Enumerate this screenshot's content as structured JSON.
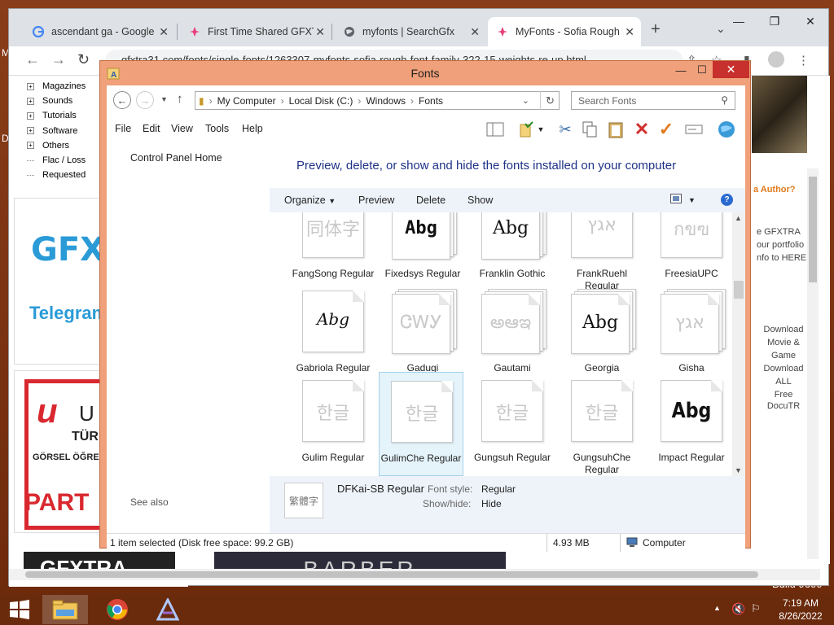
{
  "desktop": {
    "build_fragment": "Build 9600",
    "left_fragment_1": "M",
    "left_fragment_2": "D"
  },
  "browser": {
    "tabs": [
      {
        "title": "ascendant ga - Google",
        "icon": "google-icon"
      },
      {
        "title": "First Time Shared GFXT",
        "icon": "gfxtra-icon"
      },
      {
        "title": "myfonts | SearchGfx",
        "icon": "globe-icon"
      },
      {
        "title": "MyFonts - Sofia Rough",
        "icon": "gfxtra-icon"
      }
    ],
    "url": "gfxtra31.com/fonts/single-fonts/1263307-myfonts-sofia-rough-font-family-322-15-weights-re-up.html",
    "tree_items": [
      "Magazines",
      "Sounds",
      "Tutorials",
      "Software",
      "Others",
      "Flac / Loss",
      "Requested"
    ],
    "left_banner_1": "GFX",
    "left_banner_2": "Telegram",
    "ad_tur": "TÜR",
    "ad_gorsel": "GÖRSEL ÖĞRE",
    "ad_part": "PART",
    "ad_u": "u",
    "ad_u2": "U",
    "bottom_banner_1": "GFXTRA",
    "bottom_banner_2": "BARBER",
    "right_col": {
      "author_q": "a Author?",
      "gfxtra_text": "e GFXTRA\nour portfolio\nnfo to HERE",
      "download_movie": "Download\nMovie & Game",
      "download_all": "Download ALL\nFree",
      "docutr": "DocuTR"
    }
  },
  "explorer": {
    "title": "Fonts",
    "breadcrumb": [
      "My Computer",
      "Local Disk (C:)",
      "Windows",
      "Fonts"
    ],
    "search_placeholder": "Search Fonts",
    "menu": [
      "File",
      "Edit",
      "View",
      "Tools",
      "Help"
    ],
    "left": {
      "control_panel_home": "Control Panel Home",
      "see_also": "See also"
    },
    "heading": "Preview, delete, or show and hide the fonts installed on your computer",
    "commands": [
      "Organize",
      "Preview",
      "Delete",
      "Show"
    ],
    "fonts": [
      {
        "name": "FangSong Regular",
        "sample": "同体字",
        "style": "faded"
      },
      {
        "name": "Fixedsys Regular",
        "sample": "Abg",
        "style": "bold-stack"
      },
      {
        "name": "Franklin Gothic",
        "sample": "Abg",
        "style": "stack"
      },
      {
        "name": "FrankRuehl Regular",
        "sample": "אגץ",
        "style": "faded"
      },
      {
        "name": "FreesiaUPC",
        "sample": "กขฃ",
        "style": "faded"
      },
      {
        "name": "Gabriola Regular",
        "sample": "Abg",
        "style": "single"
      },
      {
        "name": "Gadugi",
        "sample": "ᏣᎳᎩ",
        "style": "faded-stack"
      },
      {
        "name": "Gautami",
        "sample": "అఆఇ",
        "style": "faded-stack"
      },
      {
        "name": "Georgia",
        "sample": "Abg",
        "style": "stack"
      },
      {
        "name": "Gisha",
        "sample": "אגץ",
        "style": "faded-stack"
      },
      {
        "name": "Gulim Regular",
        "sample": "한글",
        "style": "faded"
      },
      {
        "name": "GulimChe Regular",
        "sample": "한글",
        "style": "faded-selected"
      },
      {
        "name": "Gungsuh Regular",
        "sample": "한글",
        "style": "faded"
      },
      {
        "name": "GungsuhChe Regular",
        "sample": "한글",
        "style": "faded"
      },
      {
        "name": "Impact Regular",
        "sample": "Abg",
        "style": "impact"
      }
    ],
    "selected_index": 11,
    "details": {
      "name": "DFKai-SB Regular",
      "preview": "繁體字",
      "style_label": "Font style:",
      "style_value": "Regular",
      "showhide_label": "Show/hide:",
      "showhide_value": "Hide"
    },
    "status": {
      "selected": "1 item selected (Disk free space: 99.2 GB)",
      "size": "4.93 MB",
      "location": "Computer"
    }
  },
  "taskbar": {
    "time": "7:19 AM",
    "date": "8/26/2022"
  }
}
